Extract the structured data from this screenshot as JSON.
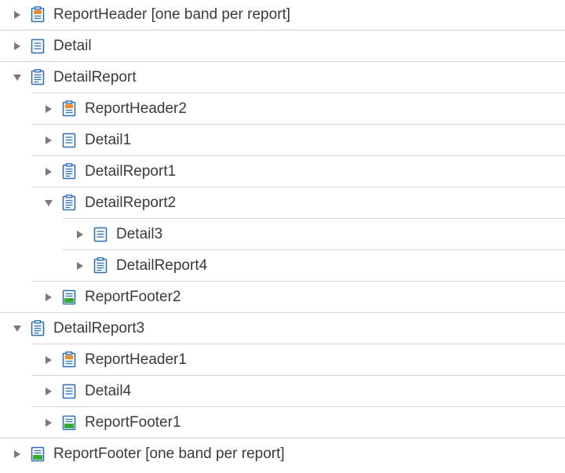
{
  "tree": {
    "rows": [
      {
        "label": "ReportHeader [one band per report]",
        "level": 0,
        "expanded": false,
        "icon": "report-header-icon"
      },
      {
        "label": "Detail",
        "level": 0,
        "expanded": false,
        "icon": "detail-band-icon"
      },
      {
        "label": "DetailReport",
        "level": 0,
        "expanded": true,
        "icon": "detail-report-icon"
      },
      {
        "label": "ReportHeader2",
        "level": 1,
        "expanded": false,
        "icon": "report-header-icon"
      },
      {
        "label": "Detail1",
        "level": 1,
        "expanded": false,
        "icon": "detail-band-icon"
      },
      {
        "label": "DetailReport1",
        "level": 1,
        "expanded": false,
        "icon": "detail-report-icon"
      },
      {
        "label": "DetailReport2",
        "level": 1,
        "expanded": true,
        "icon": "detail-report-icon"
      },
      {
        "label": "Detail3",
        "level": 2,
        "expanded": false,
        "icon": "detail-band-icon"
      },
      {
        "label": "DetailReport4",
        "level": 2,
        "expanded": false,
        "icon": "detail-report-icon"
      },
      {
        "label": "ReportFooter2",
        "level": 1,
        "expanded": false,
        "icon": "report-footer-icon"
      },
      {
        "label": "DetailReport3",
        "level": 0,
        "expanded": true,
        "icon": "detail-report-icon"
      },
      {
        "label": "ReportHeader1",
        "level": 1,
        "expanded": false,
        "icon": "report-header-icon"
      },
      {
        "label": "Detail4",
        "level": 1,
        "expanded": false,
        "icon": "detail-band-icon"
      },
      {
        "label": "ReportFooter1",
        "level": 1,
        "expanded": false,
        "icon": "report-footer-icon"
      },
      {
        "label": "ReportFooter [one band per report]",
        "level": 0,
        "expanded": false,
        "icon": "report-footer-icon"
      }
    ]
  },
  "colors": {
    "header_accent": "#f28c28",
    "footer_accent": "#3aa935",
    "icon_blue": "#2f6fb5",
    "arrow": "#7a7a7a",
    "border": "#d6d6d6",
    "text": "#3a3a3a"
  }
}
